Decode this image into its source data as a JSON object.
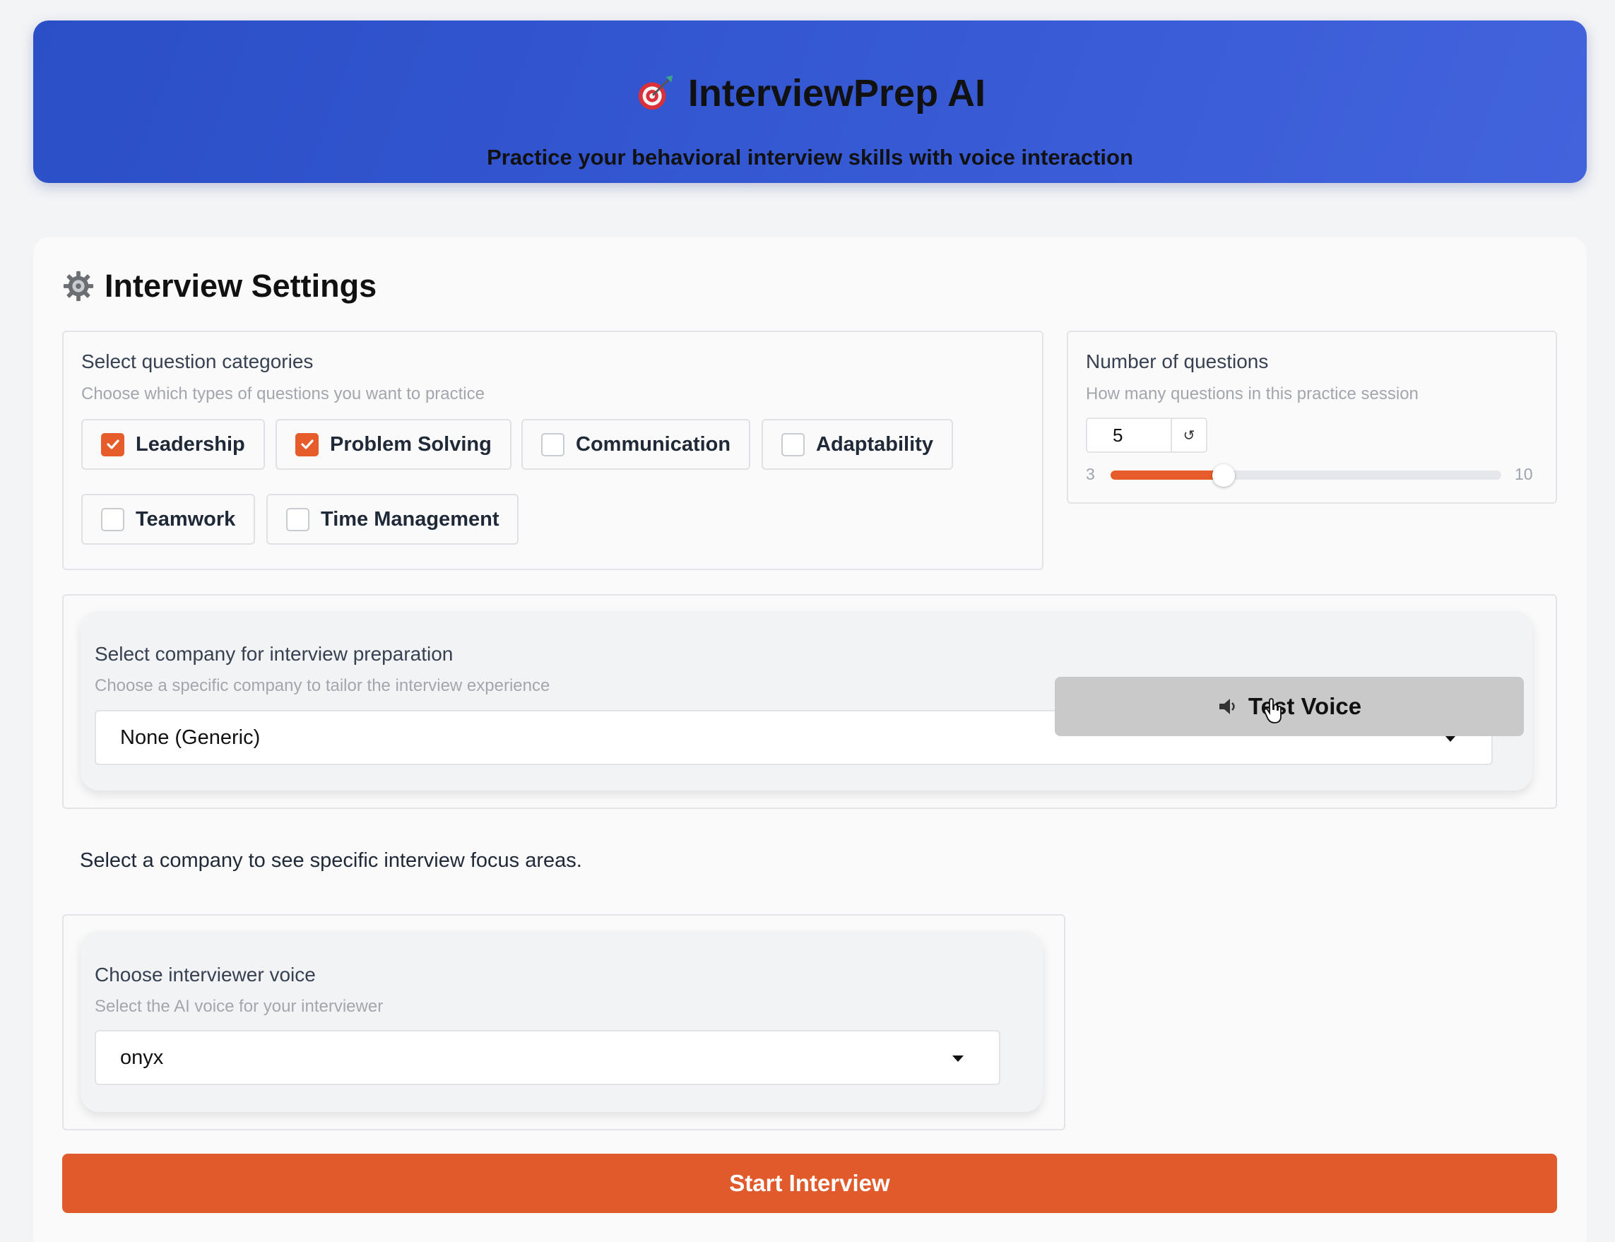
{
  "header": {
    "title": "InterviewPrep AI",
    "subtitle": "Practice your behavioral interview skills with voice interaction",
    "icon": "target-icon"
  },
  "settings": {
    "title": "Interview Settings",
    "icon": "gear-icon",
    "categories": {
      "label": "Select question categories",
      "hint": "Choose which types of questions you want to practice",
      "items": [
        {
          "label": "Leadership",
          "checked": true
        },
        {
          "label": "Problem Solving",
          "checked": true
        },
        {
          "label": "Communication",
          "checked": false
        },
        {
          "label": "Adaptability",
          "checked": false
        },
        {
          "label": "Teamwork",
          "checked": false
        },
        {
          "label": "Time Management",
          "checked": false
        }
      ]
    },
    "questions": {
      "label": "Number of questions",
      "hint": "How many questions in this practice session",
      "value": "5",
      "reset_icon": "↺",
      "min": "3",
      "max": "10"
    },
    "company": {
      "label": "Select company for interview preparation",
      "hint": "Choose a specific company to tailor the interview experience",
      "selected": "None (Generic)"
    },
    "focus_message": "Select a company to see specific interview focus areas.",
    "voice": {
      "label": "Choose interviewer voice",
      "hint": "Select the AI voice for your interviewer",
      "selected": "onyx"
    },
    "test_voice_label": "Test Voice",
    "start_label": "Start Interview"
  },
  "colors": {
    "accent": "#e65c2a",
    "banner": "#3457d2"
  }
}
